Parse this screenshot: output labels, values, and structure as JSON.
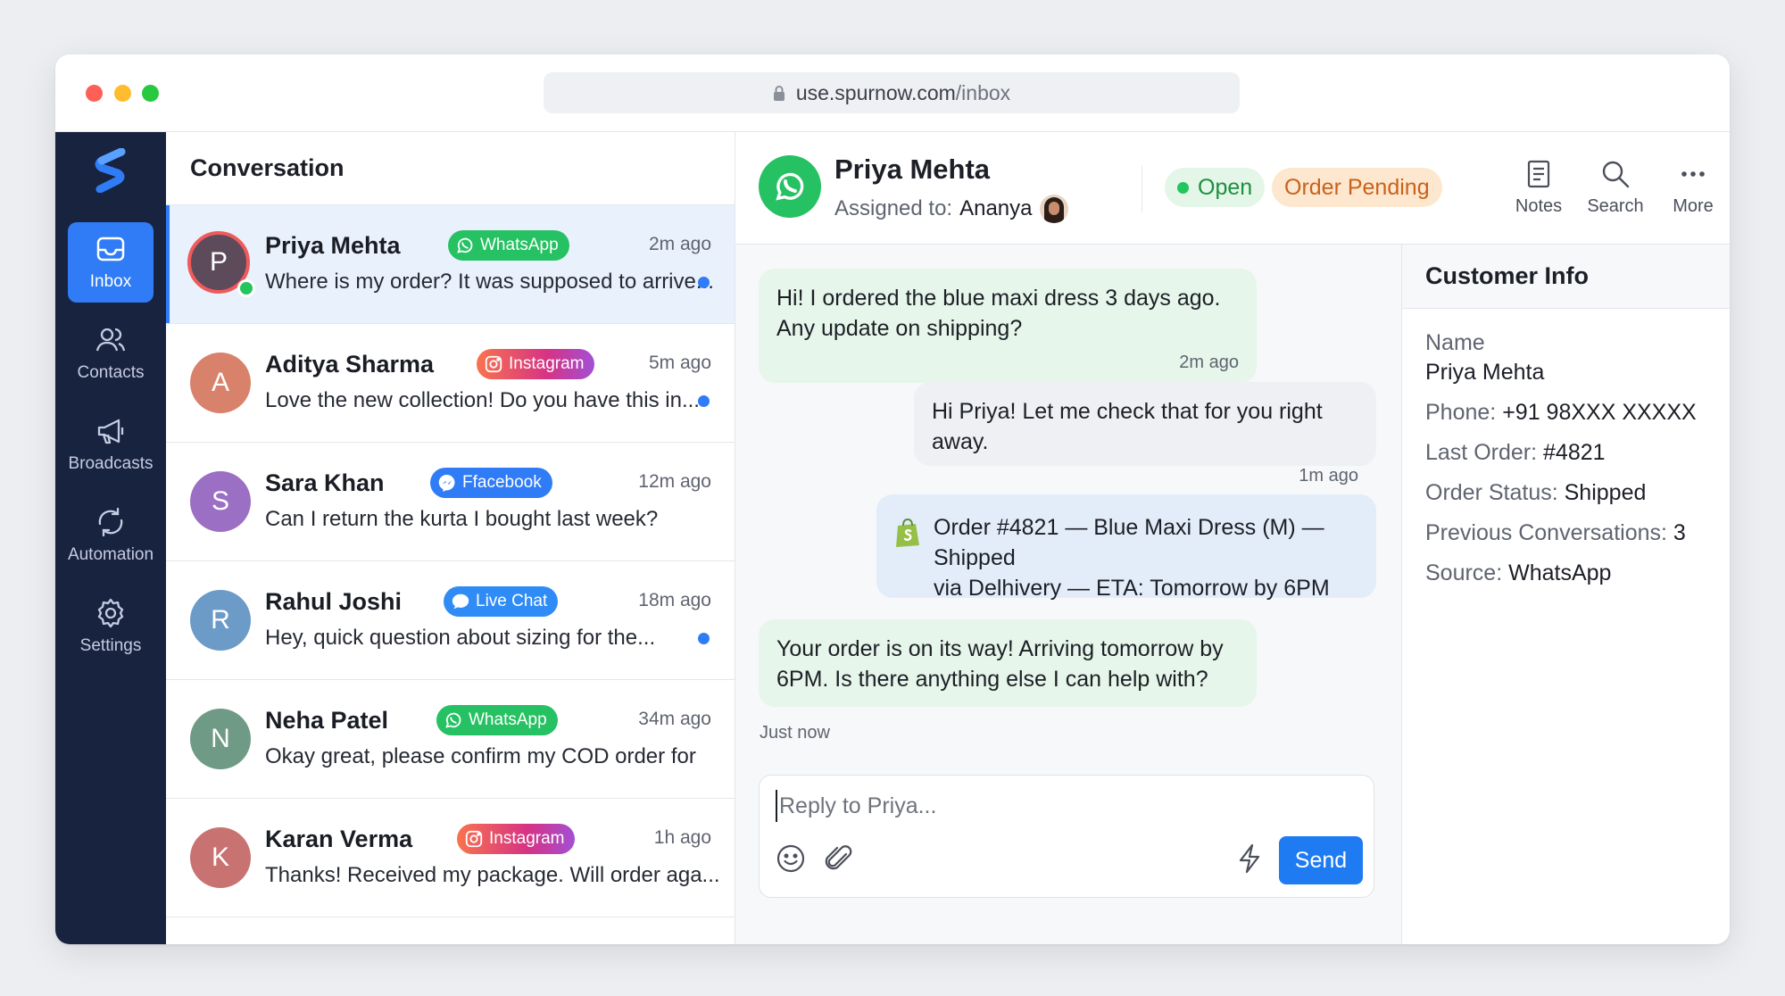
{
  "browser": {
    "url_host": "use.spurnow.com",
    "url_path": "/inbox"
  },
  "nav": {
    "items": [
      {
        "label": "Inbox",
        "icon": "inbox-icon",
        "active": true
      },
      {
        "label": "Contacts",
        "icon": "contacts-icon"
      },
      {
        "label": "Broadcasts",
        "icon": "megaphone-icon"
      },
      {
        "label": "Automation",
        "icon": "automation-icon"
      },
      {
        "label": "Settings",
        "icon": "gear-icon"
      }
    ]
  },
  "conversations": {
    "title": "Conversation",
    "items": [
      {
        "initial": "P",
        "name": "Priya Mehta",
        "channel": "WhatsApp",
        "time": "2m ago",
        "preview": "Where is my order? It was supposed to arrive...",
        "unread": true,
        "active": true,
        "avatar_color": "#5d4a5b"
      },
      {
        "initial": "A",
        "name": "Aditya Sharma",
        "channel": "Instagram",
        "time": "5m ago",
        "preview": "Love the new collection! Do you have this in...",
        "unread": true,
        "avatar_color": "#d9826b"
      },
      {
        "initial": "S",
        "name": "Sara Khan",
        "channel": "Ffacebook",
        "time": "12m ago",
        "preview": "Can I return the kurta I bought last week?",
        "unread": false,
        "avatar_color": "#9b6fc3"
      },
      {
        "initial": "R",
        "name": "Rahul Joshi",
        "channel": "Live Chat",
        "time": "18m ago",
        "preview": "Hey, quick question about sizing for the...",
        "unread": true,
        "avatar_color": "#6c9bc8"
      },
      {
        "initial": "N",
        "name": "Neha Patel",
        "channel": "WhatsApp",
        "time": "34m ago",
        "preview": "Okay great, please confirm my COD order for",
        "unread": false,
        "avatar_color": "#6f9a86"
      },
      {
        "initial": "K",
        "name": "Karan Verma",
        "channel": "Instagram",
        "time": "1h ago",
        "preview": "Thanks! Received my package. Will order aga...",
        "unread": false,
        "avatar_color": "#c97272"
      }
    ]
  },
  "chat": {
    "contact_name": "Priya Mehta",
    "assigned_label": "Assigned to:",
    "assigned_agent": "Ananya",
    "status": "Open",
    "tag": "Order Pending",
    "actions": [
      {
        "label": "Notes",
        "icon": "notes-icon"
      },
      {
        "label": "Search",
        "icon": "search-icon"
      },
      {
        "label": "More",
        "icon": "more-icon"
      }
    ],
    "messages": [
      {
        "direction": "in",
        "lines": [
          "Hi! I ordered the blue maxi dress 3 days ago.",
          "Any update on shipping?"
        ],
        "time": "2m ago"
      },
      {
        "direction": "out",
        "lines": [
          "Hi Priya! Let me check that for you right away."
        ],
        "time": "1m ago"
      },
      {
        "direction": "order",
        "lines": [
          "Order #4821 — Blue Maxi Dress (M) — Shipped",
          "via Delhivery — ETA: Tomorrow by 6PM"
        ]
      },
      {
        "direction": "in",
        "lines": [
          "Your order is on its way! Arriving tomorrow by",
          "6PM. Is there anything else I can help with?"
        ]
      }
    ],
    "last_time": "Just now",
    "reply_placeholder": "Reply to Priya...",
    "send_label": "Send"
  },
  "customer_info": {
    "title": "Customer Info",
    "name_label": "Name",
    "name": "Priya Mehta",
    "phone_label": "Phone:",
    "phone": "+91 98XXX XXXXX",
    "last_order_label": "Last Order:",
    "last_order": "#4821",
    "order_status_label": "Order Status:",
    "order_status": "Shipped",
    "prev_conv_label": "Previous Conversations:",
    "prev_conv": "3",
    "source_label": "Source:",
    "source": "WhatsApp"
  },
  "colors": {
    "accent": "#2f7cf6",
    "nav_bg": "#18233f",
    "whatsapp": "#25c162",
    "pending": "#c9621a"
  }
}
